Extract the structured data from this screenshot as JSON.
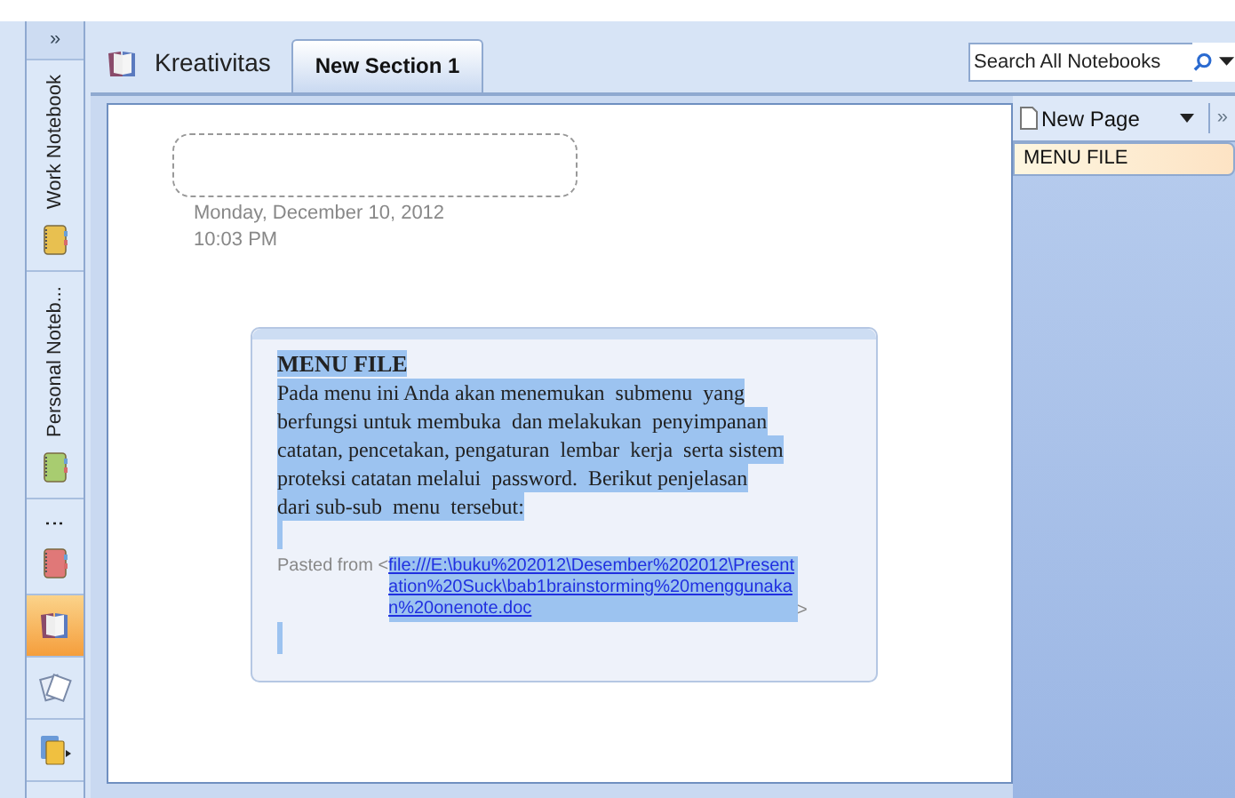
{
  "sidebar": {
    "expand_button": "»",
    "notebooks": [
      {
        "kind": "notebook",
        "label": "Work Notebook",
        "color": "#e8c050",
        "selected": false
      },
      {
        "kind": "notebook",
        "label": "Personal Noteb...",
        "color": "#a8cc70",
        "selected": false
      },
      {
        "kind": "notebook",
        "label": "⋮",
        "color": "#e07878",
        "selected": false
      },
      {
        "kind": "open",
        "selected": true
      },
      {
        "kind": "unfiled",
        "selected": false
      },
      {
        "kind": "all",
        "selected": false
      }
    ]
  },
  "header": {
    "notebook_title": "Kreativitas",
    "tabs": [
      {
        "label": "New Section 1",
        "selected": true
      }
    ],
    "search": {
      "placeholder": "Search All Notebooks"
    }
  },
  "page": {
    "title_placeholder_shown": true,
    "date": "Monday, December  10, 2012",
    "time": "10:03 PM",
    "note": {
      "heading": "MENU FILE",
      "body_lines": [
        "Pada menu ini Anda akan menemukan  submenu  yang",
        "berfungsi untuk membuka  dan melakukan  penyimpanan",
        "catatan, pencetakan, pengaturan  lembar  kerja  serta sistem",
        "proteksi catatan melalui  password.  Berikut penjelasan",
        "dari sub-sub  menu  tersebut:"
      ],
      "pasted_prefix": "Pasted from <",
      "link": "file:///E:\\buku%202012\\Desember%202012\\Presentation%20Suck\\bab1brainstorming%20menggunakan%20onenote.doc",
      "pasted_suffix": ">"
    }
  },
  "pages_panel": {
    "new_page": "New Page",
    "more": "»",
    "pages": [
      {
        "title": "MENU FILE",
        "selected": true
      }
    ]
  }
}
